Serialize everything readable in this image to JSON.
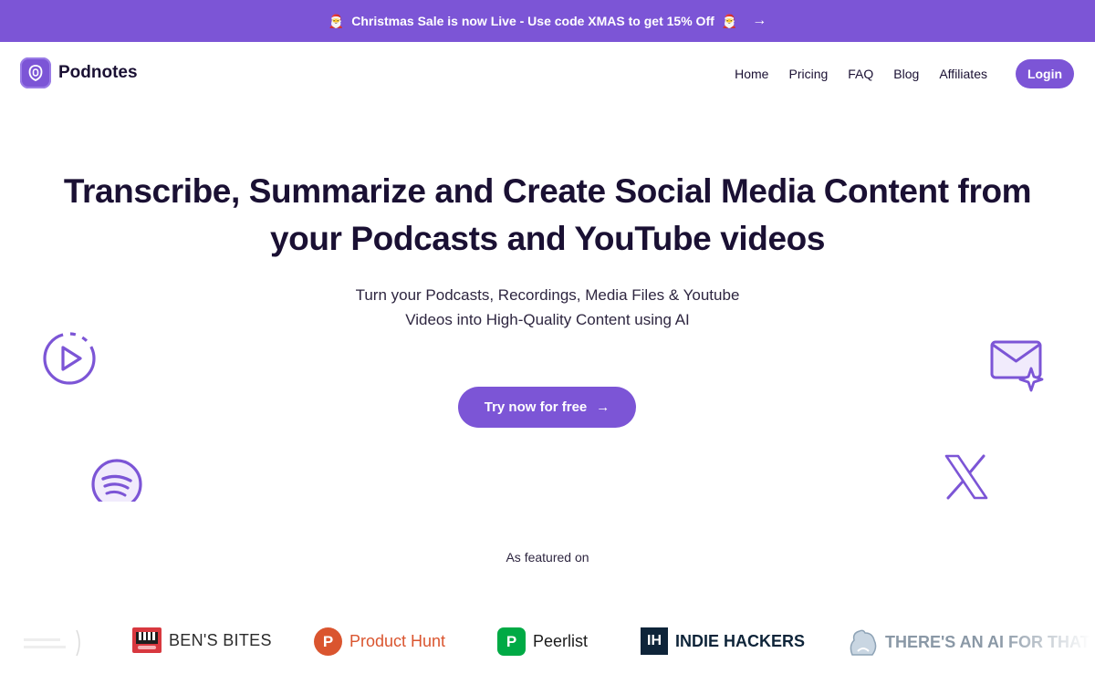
{
  "banner": {
    "text": "Christmas Sale is now Live - Use code XMAS to get 15% Off",
    "emoji": "🎅",
    "arrow": "→"
  },
  "nav": {
    "brand": "Podnotes",
    "items": [
      {
        "label": "Home"
      },
      {
        "label": "Pricing"
      },
      {
        "label": "FAQ"
      },
      {
        "label": "Blog"
      },
      {
        "label": "Affiliates"
      }
    ],
    "login_label": "Login"
  },
  "hero": {
    "title_line1": "Transcribe, Summarize and Create Social Media Content from",
    "title_line2": "your Podcasts and YouTube videos",
    "subtitle_line1": "Turn your Podcasts, Recordings, Media Files & Youtube",
    "subtitle_line2": "Videos into High-Quality Content using AI",
    "cta_label": "Try now for free",
    "cta_arrow": "→"
  },
  "featured": {
    "label": "As featured on",
    "logos": [
      {
        "name": "BEN'S BITES",
        "icon": "bens-bites-icon"
      },
      {
        "name": "Product Hunt",
        "icon": "product-hunt-icon",
        "badge": "P"
      },
      {
        "name": "Peerlist",
        "icon": "peerlist-icon",
        "badge": "P"
      },
      {
        "name": "INDIE HACKERS",
        "icon": "indie-hackers-icon",
        "badge": "IH"
      },
      {
        "name": "THERE'S AN AI FOR THAT",
        "icon": "theres-an-ai-icon"
      }
    ]
  },
  "colors": {
    "accent": "#7c55d6",
    "text": "#1a1033",
    "product_hunt": "#da552f",
    "peerlist": "#00aa45",
    "indie_hackers": "#0e2439"
  }
}
